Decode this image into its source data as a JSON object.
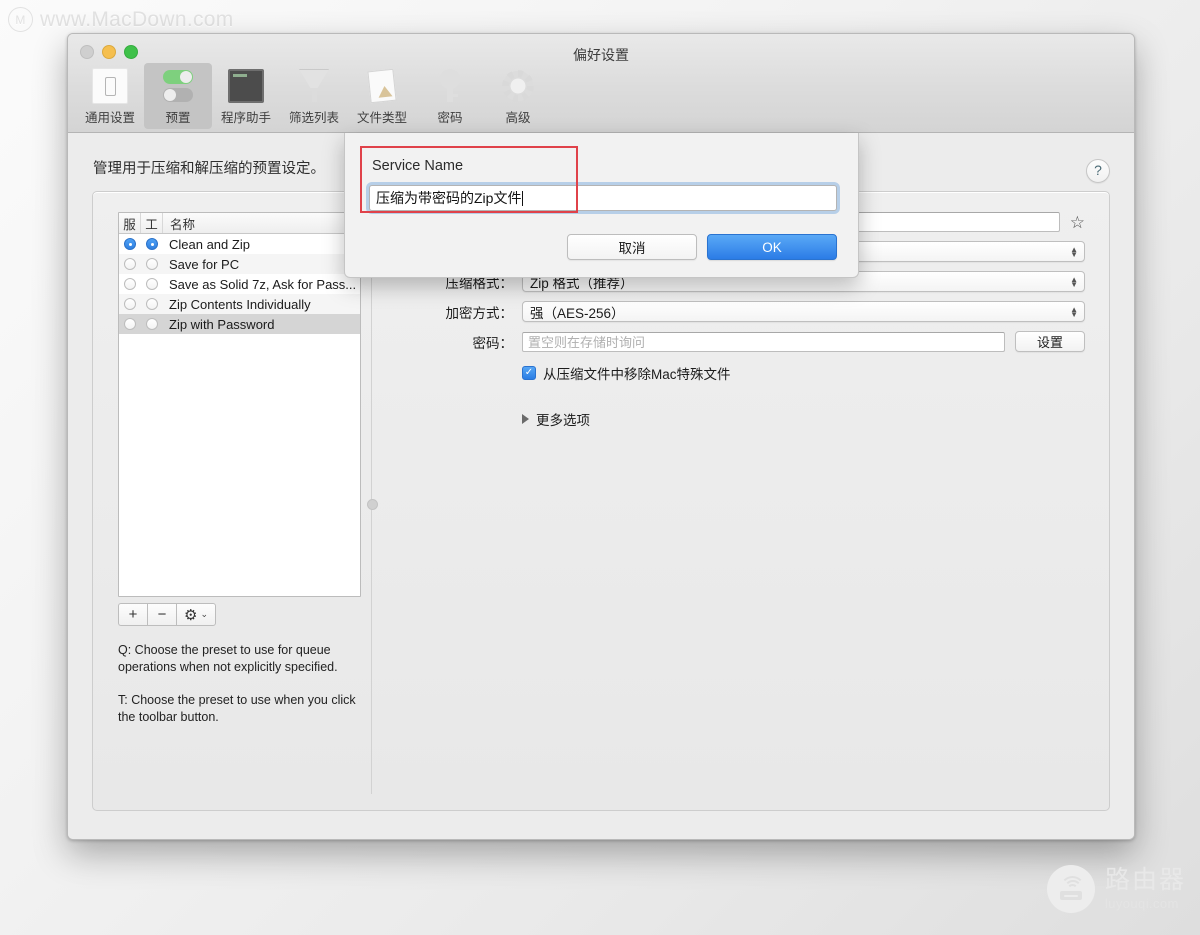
{
  "watermarks": {
    "top": "www.MacDown.com",
    "bottom_cn": "路由器",
    "bottom_en": "luyouqi.com"
  },
  "window": {
    "title": "偏好设置",
    "toolbar": [
      {
        "label": "通用设置",
        "icon": "general-settings-icon",
        "selected": false
      },
      {
        "label": "预置",
        "icon": "presets-toggle-icon",
        "selected": true
      },
      {
        "label": "程序助手",
        "icon": "chip-helper-icon",
        "selected": false
      },
      {
        "label": "筛选列表",
        "icon": "funnel-filter-icon",
        "selected": false
      },
      {
        "label": "文件类型",
        "icon": "document-type-icon",
        "selected": false
      },
      {
        "label": "密码",
        "icon": "key-password-icon",
        "selected": false
      },
      {
        "label": "高级",
        "icon": "gear-advanced-icon",
        "selected": false
      }
    ]
  },
  "page": {
    "description": "管理用于压缩和解压缩的预置设定。",
    "help_button": "?"
  },
  "presets": {
    "columns": [
      "服",
      "工",
      "名称"
    ],
    "rows": [
      {
        "queue": true,
        "toolbar": true,
        "name": "Clean and Zip",
        "selected": false
      },
      {
        "queue": false,
        "toolbar": false,
        "name": "Save for PC",
        "selected": false
      },
      {
        "queue": false,
        "toolbar": false,
        "name": "Save as Solid 7z, Ask for Pass...",
        "selected": false
      },
      {
        "queue": false,
        "toolbar": false,
        "name": "Zip Contents Individually",
        "selected": false
      },
      {
        "queue": false,
        "toolbar": false,
        "name": "Zip with Password",
        "selected": true
      }
    ],
    "tools": {
      "add": "+",
      "remove": "−",
      "gear": "gear-icon",
      "caret": "⌄"
    },
    "notes": [
      "Q: Choose the preset to use for queue operations when not explicitly specified.",
      "T: Choose the preset to use when you click the toolbar button."
    ]
  },
  "detail": {
    "name_field": {
      "value": "",
      "favorite_icon": "star-icon"
    },
    "top_select": {
      "value": ""
    },
    "format": {
      "label": "压缩格式：",
      "value": "Zip 格式（推荐）"
    },
    "encryption": {
      "label": "加密方式：",
      "value": "强（AES-256）"
    },
    "password": {
      "label": "密码：",
      "placeholder": "置空则在存储时询问",
      "value": "",
      "button": "设置"
    },
    "remove_mac_files": {
      "label": "从压缩文件中移除Mac特殊文件",
      "checked": true,
      "check_glyph": "✓"
    },
    "more_options": {
      "label": "更多选项",
      "expanded": false
    }
  },
  "sheet": {
    "title": "Service Name",
    "input_value": "压缩为带密码的Zip文件",
    "cancel_label": "取消",
    "ok_label": "OK"
  },
  "colors": {
    "accent_blue": "#2b7ce6",
    "annotation_red": "#e0424a",
    "selected_row": "#d5d5d5"
  }
}
